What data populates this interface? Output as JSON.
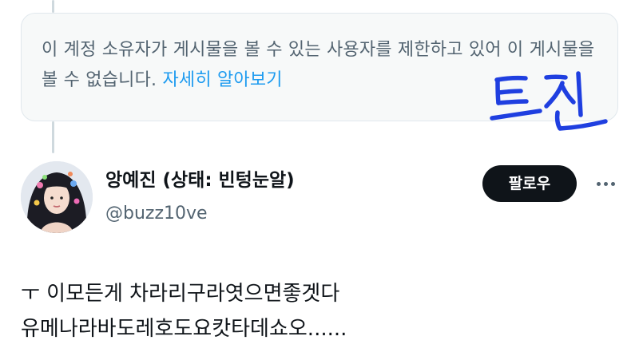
{
  "notice": {
    "text": "이 계정 소유자가 게시물을 볼 수 있는 사용자를 제한하고 있어 이 게시물을 볼 수 없습니다.",
    "link_label": "자세히 알아보기"
  },
  "annotation": {
    "handwritten_text": "트친",
    "color": "#1f3fe0"
  },
  "author": {
    "display_name": "앙예진 (상태: 빈텅눈알)",
    "handle": "@buzz10ve"
  },
  "follow_button": {
    "label": "팔로우"
  },
  "more_menu": {
    "icon": "more-horizontal-icon"
  },
  "tweet": {
    "line1": "ㅜ 이모든게 차라리구라엿으면좋겟다",
    "line2": "유메나라바도레호도요캇타데쇼오......"
  },
  "colors": {
    "link": "#1d9bf0",
    "text_primary": "#0f1419",
    "text_secondary": "#536471",
    "notice_bg": "#f7f9f9"
  }
}
